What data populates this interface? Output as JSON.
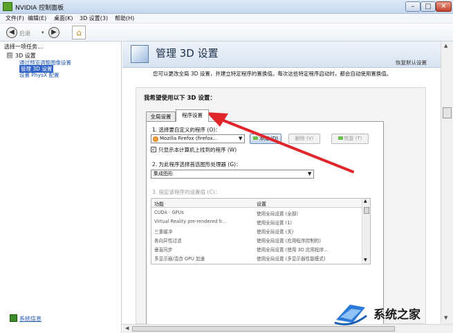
{
  "window": {
    "title": "NVIDIA 控制面板",
    "minimize": "–",
    "maximize": "□",
    "close": "✕"
  },
  "menu": [
    "文件(F)",
    "编辑(E)",
    "桌面(K)",
    "3D 设置(3)",
    "帮助(H)"
  ],
  "toolbar": {
    "back_label": "后退",
    "back_drop": "▾"
  },
  "left": {
    "task_header": "选择一项任务...",
    "root_toggle": "⊟",
    "root": "3D 设置",
    "items": [
      "通过预览调整图像设置",
      "管理 3D 设置",
      "设置 PhysX 配置"
    ],
    "sysinfo": "系统信息"
  },
  "page": {
    "title": "管理 3D 设置",
    "restore": "恢复默认设置",
    "description": "您可以更改全局 3D 设置，并建立特定程序的置换值。每次这些特定程序启动时，都会自动使用置换值。",
    "heading": "我希望使用以下 3D 设置：",
    "tabs": [
      "全局设置",
      "程序设置"
    ],
    "step1": "1. 选择要自定义的程序 (O)：",
    "program": "Mozilla Firefox (firefox...",
    "add": "添加 (D)",
    "remove": "删除 (V)",
    "reset": "恢复 (T)",
    "checkbox_label": "只显示本计算机上找到的程序 (W)",
    "checkbox_mark": "✓",
    "step2": "2. 为此程序选择首选图形处理器 (G)：",
    "gpu": "集成图形",
    "step3": "3. 指定该程序的设置值 (C)：",
    "table_headers": [
      "功能",
      "设置"
    ],
    "rows": [
      [
        "CUDA - GPUs",
        "使用全局设置 (全部)"
      ],
      [
        "Virtual Reality pre-rendered fr...",
        "使用全局设置 (1)"
      ],
      [
        "三重缓冲",
        "使用全局设置 (关)"
      ],
      [
        "各向异性过滤",
        "使用全局设置 (应用程序控制的)"
      ],
      [
        "垂直同步",
        "使用全局设置 (使用 3D 应用程序..."
      ],
      [
        "多显示器/混合 GPU 加速",
        "使用全局设置 (多显示器性能模式)"
      ]
    ]
  },
  "watermark": {
    "text": "系统之家"
  }
}
